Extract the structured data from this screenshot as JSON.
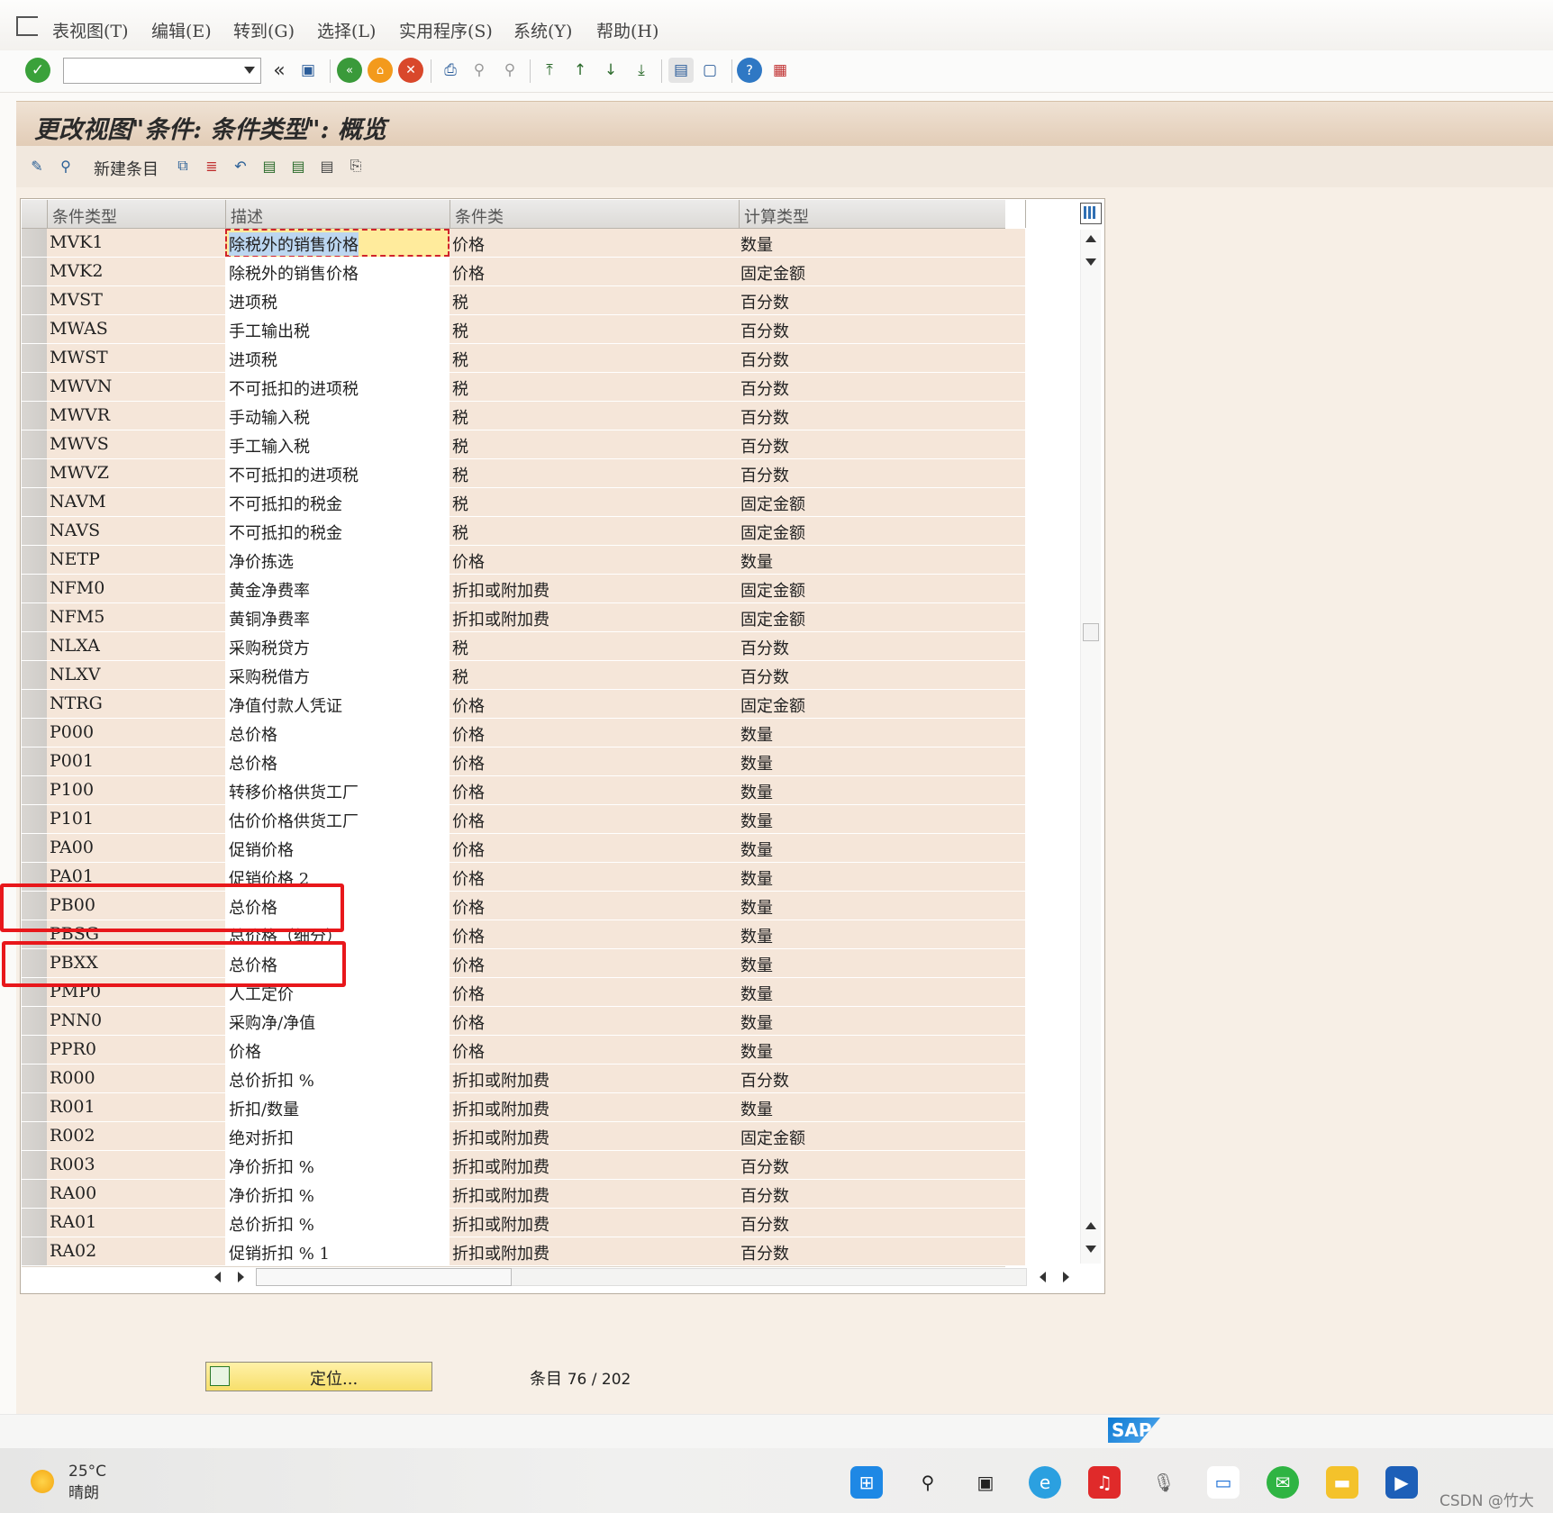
{
  "menu": [
    "表视图(T)",
    "编辑(E)",
    "转到(G)",
    "选择(L)",
    "实用程序(S)",
    "系统(Y)",
    "帮助(H)"
  ],
  "command_field": {
    "value": "",
    "placeholder": ""
  },
  "title": "更改视图\"条件: 条件类型\": 概览",
  "app_toolbar": {
    "new_entries_label": "新建条目"
  },
  "table": {
    "columns": [
      "条件类型",
      "描述",
      "条件类",
      "计算类型"
    ],
    "rows": [
      [
        "MVK1",
        "除税外的销售价格",
        "价格",
        "数量"
      ],
      [
        "MVK2",
        "除税外的销售价格",
        "价格",
        "固定金额"
      ],
      [
        "MVST",
        "进项税",
        "税",
        "百分数"
      ],
      [
        "MWAS",
        "手工输出税",
        "税",
        "百分数"
      ],
      [
        "MWST",
        "进项税",
        "税",
        "百分数"
      ],
      [
        "MWVN",
        "不可抵扣的进项税",
        "税",
        "百分数"
      ],
      [
        "MWVR",
        "手动输入税",
        "税",
        "百分数"
      ],
      [
        "MWVS",
        "手工输入税",
        "税",
        "百分数"
      ],
      [
        "MWVZ",
        "不可抵扣的进项税",
        "税",
        "百分数"
      ],
      [
        "NAVM",
        "不可抵扣的税金",
        "税",
        "固定金额"
      ],
      [
        "NAVS",
        "不可抵扣的税金",
        "税",
        "固定金额"
      ],
      [
        "NETP",
        "净价拣选",
        "价格",
        "数量"
      ],
      [
        "NFM0",
        "黄金净费率",
        "折扣或附加费",
        "固定金额"
      ],
      [
        "NFM5",
        "黄铜净费率",
        "折扣或附加费",
        "固定金额"
      ],
      [
        "NLXA",
        "采购税贷方",
        "税",
        "百分数"
      ],
      [
        "NLXV",
        "采购税借方",
        "税",
        "百分数"
      ],
      [
        "NTRG",
        "净值付款人凭证",
        "价格",
        "固定金额"
      ],
      [
        "P000",
        "总价格",
        "价格",
        "数量"
      ],
      [
        "P001",
        "总价格",
        "价格",
        "数量"
      ],
      [
        "P100",
        "转移价格供货工厂",
        "价格",
        "数量"
      ],
      [
        "P101",
        "估价价格供货工厂",
        "价格",
        "数量"
      ],
      [
        "PA00",
        "促销价格",
        "价格",
        "数量"
      ],
      [
        "PA01",
        "促销价格 2",
        "价格",
        "数量"
      ],
      [
        "PB00",
        "总价格",
        "价格",
        "数量"
      ],
      [
        "PBSG",
        "总价格（细分）",
        "价格",
        "数量"
      ],
      [
        "PBXX",
        "总价格",
        "价格",
        "数量"
      ],
      [
        "PMP0",
        "人工定价",
        "价格",
        "数量"
      ],
      [
        "PNN0",
        "采购净/净值",
        "价格",
        "数量"
      ],
      [
        "PPR0",
        "价格",
        "价格",
        "数量"
      ],
      [
        "R000",
        "总价折扣 %",
        "折扣或附加费",
        "百分数"
      ],
      [
        "R001",
        "折扣/数量",
        "折扣或附加费",
        "数量"
      ],
      [
        "R002",
        "绝对折扣",
        "折扣或附加费",
        "固定金额"
      ],
      [
        "R003",
        "净价折扣 %",
        "折扣或附加费",
        "百分数"
      ],
      [
        "RA00",
        "净价折扣 %",
        "折扣或附加费",
        "百分数"
      ],
      [
        "RA01",
        "总价折扣 %",
        "折扣或附加费",
        "百分数"
      ],
      [
        "RA02",
        "促销折扣 % 1",
        "折扣或附加费",
        "百分数"
      ]
    ]
  },
  "position_button": "定位...",
  "entry_label": "条目",
  "entry_count": "76 / 202",
  "sap_logo": "SAP",
  "taskbar": {
    "temperature": "25°C",
    "weather": "晴朗"
  },
  "watermark": "CSDN @竹大",
  "colors": {
    "accent_red": "#e8171b",
    "title_bg": "#e2ccb6",
    "cell_bg": "#f5e6d9"
  }
}
